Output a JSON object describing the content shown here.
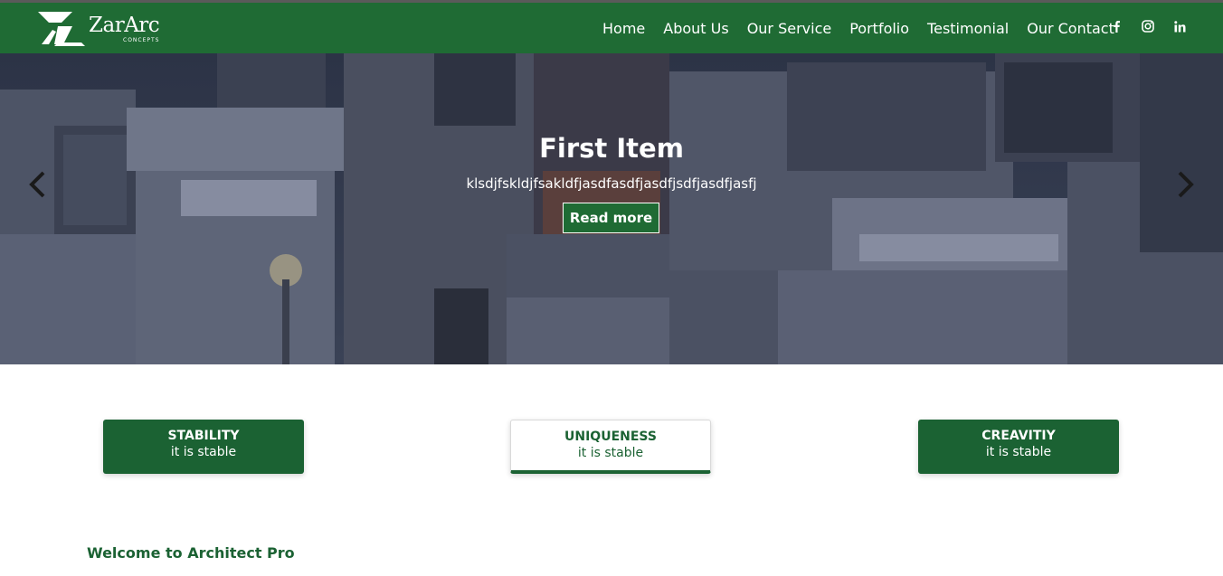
{
  "brand": {
    "name": "ZarArc",
    "subtitle": "CONCEPTS"
  },
  "nav": {
    "links": [
      "Home",
      "About Us",
      "Our Service",
      "Portfolio",
      "Testimonial",
      "Our Contact"
    ],
    "social": [
      "facebook-icon",
      "instagram-icon",
      "linkedin-icon"
    ]
  },
  "colors": {
    "primary": "#1f6b34",
    "card": "#1b6233",
    "text_on_primary": "#ffffff"
  },
  "hero": {
    "title": "First Item",
    "text": "klsdjfskldjfsakldfjasdfasdfjasdfjsdfjasdfjasfj",
    "button": "Read more",
    "prev_icon": "chevron-left-icon",
    "next_icon": "chevron-right-icon"
  },
  "features": [
    {
      "title": "STABILITY",
      "subtitle": "it is stable"
    },
    {
      "title": "UNIQUENESS",
      "subtitle": "it is stable"
    },
    {
      "title": "CREAVITIY",
      "subtitle": "it is stable"
    }
  ],
  "welcome": {
    "heading": "Welcome to Architect Pro"
  }
}
